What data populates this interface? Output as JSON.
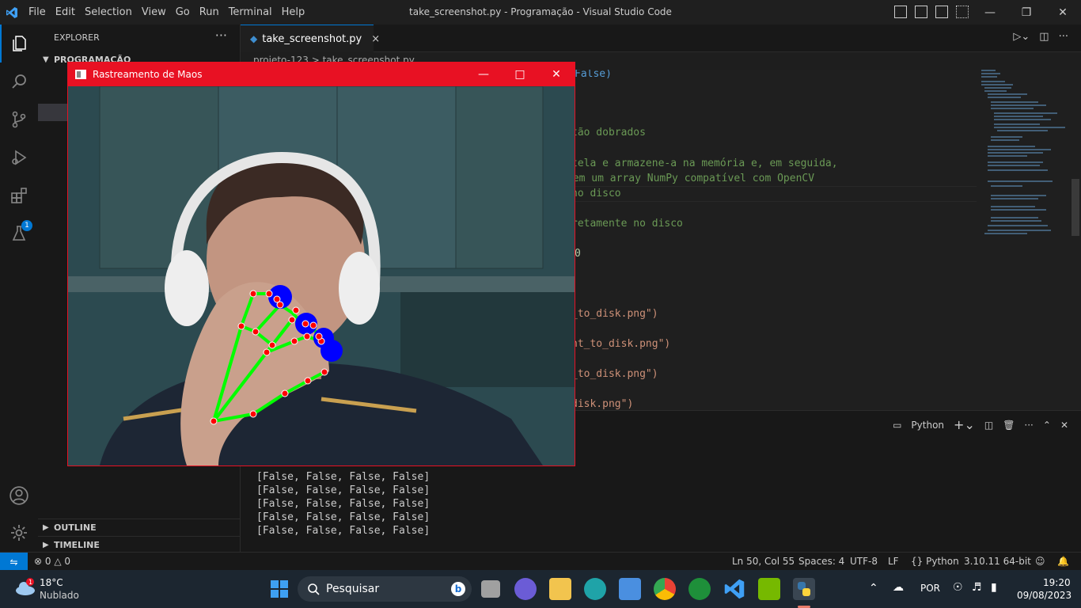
{
  "window": {
    "title": "take_screenshot.py - Programação - Visual Studio Code",
    "menu": [
      "File",
      "Edit",
      "Selection",
      "View",
      "Go",
      "Run",
      "Terminal",
      "Help"
    ]
  },
  "sidebar": {
    "header": "EXPLORER",
    "more": "···",
    "folder": "PROGRAMAÇÃO",
    "sections": [
      "OUTLINE",
      "TIMELINE"
    ]
  },
  "activity": {
    "extensions_badge": "1"
  },
  "editor": {
    "tab_label": "take_screenshot.py",
    "tab_close": "×",
    "breadcrumb": [
      "projeto-123",
      "take_screenshot.py"
    ],
    "lines": [
      "False)",
      "tão dobrados",
      "tela e armazene-a na memória e, em seguida,",
      " em um array NumPy compatível com OpenCV",
      "no disco",
      "retamente no disco",
      "0",
      "_to_disk.png\")",
      "ht_to_disk.png\")",
      "_to_disk.png\")",
      "disk.png\")"
    ]
  },
  "panel": {
    "terminal_name": "Python",
    "output": [
      "[False, False, False, False]",
      "[False, False, False, False]",
      "[False, False, False, False]",
      "[False, False, False, False]",
      "[False, False, False, False]"
    ]
  },
  "status": {
    "errors": "0",
    "warnings": "0",
    "position": "Ln 50, Col 55",
    "spaces": "Spaces: 4",
    "encoding": "UTF-8",
    "eol": "LF",
    "language": "Python",
    "interpreter": "3.10.11 64-bit"
  },
  "taskbar": {
    "weather_temp": "18°C",
    "weather_desc": "Nublado",
    "search_placeholder": "Pesquisar",
    "language": "POR",
    "time": "19:20",
    "date": "09/08/2023"
  },
  "camera_window": {
    "title": "Rastreamento de Maos"
  },
  "colors": {
    "accent": "#0078d4",
    "camera_titlebar": "#e81123",
    "landmark_line": "#00ff00",
    "landmark_point": "#ff0000",
    "fingertip_marker": "#0000ff"
  }
}
